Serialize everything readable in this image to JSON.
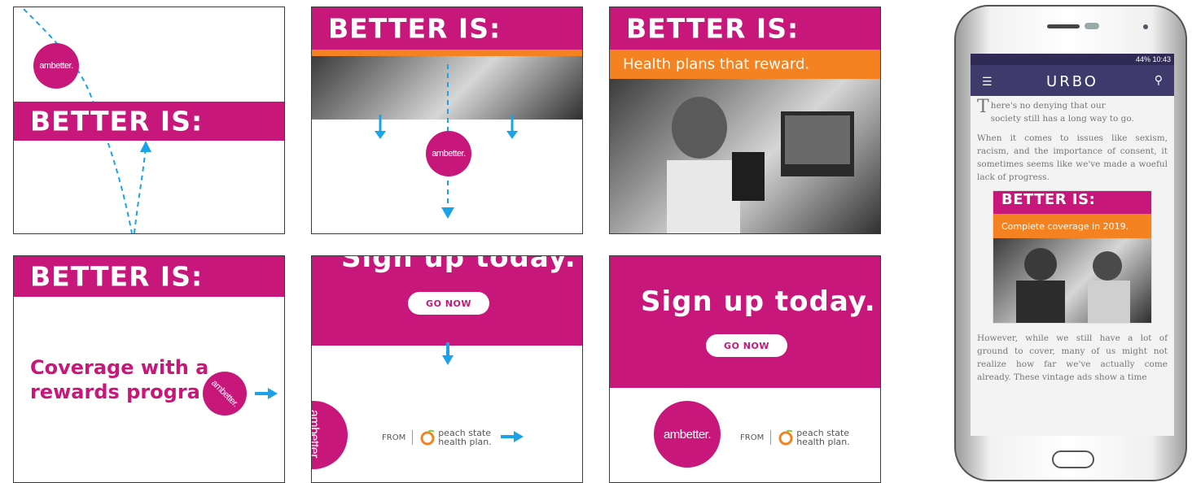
{
  "brand": {
    "magenta": "#c8177a",
    "orange": "#f58220",
    "arrow": "#1aa3e8"
  },
  "headline": "BETTER IS:",
  "logo_text": "ambetter.",
  "frame3_tagline": "Health plans that reward.",
  "frame4_text_line1": "Coverage with a",
  "frame4_text_line2": "rewards progra",
  "cta_text": "Sign up today.",
  "button_label": "GO NOW",
  "from_label": "FROM",
  "partner_line1": "peach state",
  "partner_line2": "health plan.",
  "phone": {
    "status": "44%  10:43",
    "app_title": "URBO",
    "menu_icon": "hamburger-icon",
    "search_icon": "search-icon",
    "drop_cap": "T",
    "intro_line1": "here's no denying that our",
    "intro_line2": "society still has a long way to go.",
    "paragraph1": "When it comes to issues like sexism, racism, and the importance of consent, it sometimes seems like we've made a woeful lack of progress.",
    "ad_headline": "BETTER IS:",
    "ad_tagline": "Complete coverage in 2019.",
    "paragraph2": "However, while we still have a lot of ground to cover, many of us might not realize how far we've actually come already. These vintage ads show a time"
  }
}
